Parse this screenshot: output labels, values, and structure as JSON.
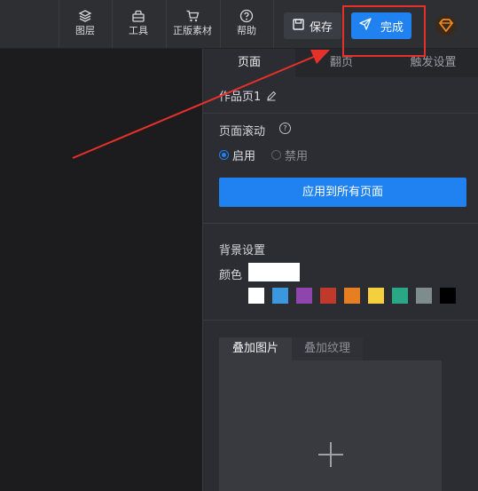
{
  "toolbar": {
    "tools": [
      {
        "label": "图层",
        "icon": "layers-icon"
      },
      {
        "label": "工具",
        "icon": "toolbox-icon"
      },
      {
        "label": "正版素材",
        "icon": "cart-icon"
      },
      {
        "label": "帮助",
        "icon": "help-icon"
      }
    ],
    "save_label": "保存",
    "done_label": "完成"
  },
  "panel": {
    "tabs": [
      "页面",
      "翻页",
      "触发设置"
    ],
    "active_tab": "页面",
    "page_name": "作品页1",
    "page_scroll": {
      "label": "页面滚动",
      "options": [
        "启用",
        "禁用"
      ],
      "selected": "启用"
    },
    "apply_all_label": "应用到所有页面",
    "background": {
      "section_label": "背景设置",
      "color_label": "颜色",
      "current_color": "#ffffff",
      "swatches": [
        "#ffffff",
        "#3b97de",
        "#8e45ad",
        "#c0392b",
        "#e67e22",
        "#f4d03f",
        "#2aa784",
        "#7f8c8d",
        "#000000"
      ]
    },
    "overlay_tabs": [
      "叠加图片",
      "叠加纹理"
    ],
    "active_overlay_tab": "叠加图片"
  },
  "colors": {
    "accent": "#1f82f0",
    "annotation": "#e8302a"
  }
}
